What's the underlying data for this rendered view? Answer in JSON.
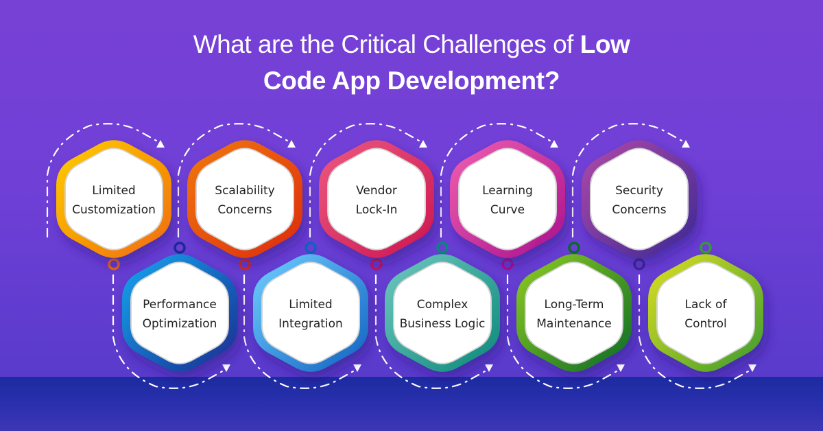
{
  "title": {
    "line1_regular": "What are the Critical Challenges of ",
    "line1_bold": "Low",
    "line2": "Code App Development?"
  },
  "colors": {
    "background": "#7841d6",
    "floor": "#1c2ba0",
    "text": "#222222"
  },
  "challenges_top": [
    {
      "lines": [
        "Limited",
        "Customization"
      ],
      "color_a": "#ffd000",
      "color_b": "#f06a0a"
    },
    {
      "lines": [
        "Scalability",
        "Concerns"
      ],
      "color_a": "#f07a10",
      "color_b": "#dd2a10"
    },
    {
      "lines": [
        "Vendor",
        "Lock-In"
      ],
      "color_a": "#ec5a80",
      "color_b": "#cc1450"
    },
    {
      "lines": [
        "Learning",
        "Curve"
      ],
      "color_a": "#f060b0",
      "color_b": "#a8108c"
    },
    {
      "lines": [
        "Security",
        "Concerns"
      ],
      "color_a": "#b04aa8",
      "color_b": "#3a2894"
    }
  ],
  "challenges_bottom": [
    {
      "lines": [
        "Performance",
        "Optimization"
      ],
      "color_a": "#10a8f0",
      "color_b": "#1c2a90"
    },
    {
      "lines": [
        "Limited",
        "Integration"
      ],
      "color_a": "#70d0ff",
      "color_b": "#1060c0"
    },
    {
      "lines": [
        "Complex",
        "Business Logic"
      ],
      "color_a": "#70c8c0",
      "color_b": "#0a8878"
    },
    {
      "lines": [
        "Long-Term",
        "Maintenance"
      ],
      "color_a": "#90cc20",
      "color_b": "#0a6a28"
    },
    {
      "lines": [
        "Lack of",
        "Control"
      ],
      "color_a": "#e0e020",
      "color_b": "#3a9a30"
    }
  ]
}
